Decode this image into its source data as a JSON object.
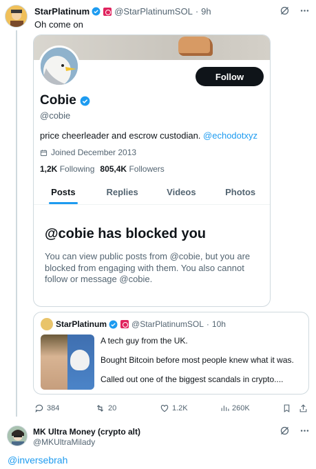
{
  "tweet": {
    "author_name": "StarPlatinum",
    "author_handle": "@StarPlatinumSOL",
    "separator": "·",
    "time": "9h",
    "text": "Oh come on"
  },
  "profile_card": {
    "name": "Cobie",
    "handle": "@cobie",
    "follow_label": "Follow",
    "bio_text": "price cheerleader and escrow custodian.",
    "bio_link": "@echodotxyz",
    "joined": "Joined December 2013",
    "following_count": "1,2K",
    "following_label": "Following",
    "followers_count": "805,4K",
    "followers_label": "Followers",
    "tabs": [
      {
        "label": "Posts"
      },
      {
        "label": "Replies"
      },
      {
        "label": "Videos"
      },
      {
        "label": "Photos"
      }
    ],
    "blocked_title": "@cobie has blocked you",
    "blocked_message": "You can view public posts from @cobie, but you are blocked from engaging with them. You also cannot follow or message @cobie."
  },
  "quote": {
    "author_name": "StarPlatinum",
    "author_handle": "@StarPlatinumSOL",
    "separator": "·",
    "time": "10h",
    "lines": [
      "A tech guy from the UK.",
      "Bought Bitcoin before most people knew what it was.",
      "Called out one of the biggest scandals in crypto...."
    ]
  },
  "actions": {
    "replies": "384",
    "reposts": "20",
    "likes": "1.2K",
    "views": "260K"
  },
  "reply": {
    "author_name": "MK Ultra Money (crypto alt)",
    "author_handle": "@MKUltraMilady",
    "text": "@inversebrah"
  },
  "colors": {
    "accent": "#1d9bf0",
    "text": "#0f1419",
    "muted": "#536471",
    "border": "#cfd9de"
  },
  "icons": [
    "verified-badge-icon",
    "affiliate-flag-icon",
    "grok-icon",
    "more-icon",
    "calendar-icon",
    "reply-icon",
    "repost-icon",
    "like-icon",
    "views-icon",
    "bookmark-icon",
    "share-icon"
  ]
}
